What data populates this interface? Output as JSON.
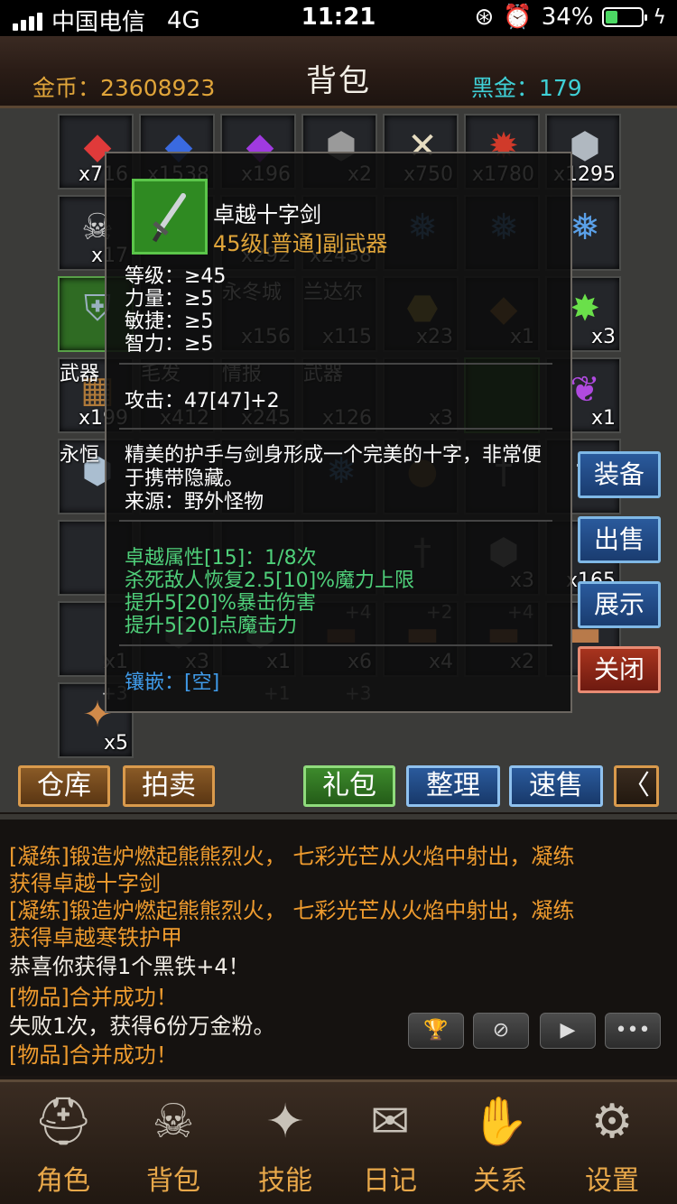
{
  "status_bar": {
    "carrier": "中国电信",
    "network": "4G",
    "time": "11:21",
    "battery": "34%"
  },
  "header": {
    "gold_label": "金币：23608923",
    "title": "背包",
    "blackgold_label": "黑金：179"
  },
  "slots": [
    {
      "icon": "◆",
      "color": "#e03a3a",
      "count": "x716"
    },
    {
      "icon": "◆",
      "color": "#3a6ae0",
      "count": "x1538"
    },
    {
      "icon": "◆",
      "color": "#a03ae0",
      "count": "x196"
    },
    {
      "icon": "⬢",
      "color": "#9a9a9a",
      "count": "x2"
    },
    {
      "icon": "✕",
      "color": "#e6dcc0",
      "count": "x750"
    },
    {
      "icon": "✹",
      "color": "#d03a2a",
      "count": "x1780"
    },
    {
      "icon": "⬢",
      "color": "#b0b8c0",
      "count": "x1295"
    },
    {
      "icon": "☠",
      "color": "#cfcfcf",
      "count": "x17"
    },
    {
      "icon": "",
      "color": "#888",
      "count": ""
    },
    {
      "icon": "",
      "color": "#888",
      "count": "x292"
    },
    {
      "icon": "",
      "color": "#888",
      "count": "x2438"
    },
    {
      "icon": "❅",
      "color": "#5aa0e8",
      "count": ""
    },
    {
      "icon": "❅",
      "color": "#5aa0e8",
      "count": ""
    },
    {
      "icon": "❅",
      "color": "#5aa0e8",
      "count": ""
    },
    {
      "icon": "⛨",
      "color": "#9ab0c0",
      "count": ""
    },
    {
      "icon": "",
      "color": "#888",
      "count": ""
    },
    {
      "icon": "",
      "color": "#888",
      "count": "x156"
    },
    {
      "icon": "",
      "color": "#888",
      "count": "x115"
    },
    {
      "icon": "⬣",
      "color": "#e6c04c",
      "count": "x23"
    },
    {
      "icon": "◆",
      "color": "#c88a3a",
      "count": "x1"
    },
    {
      "icon": "✸",
      "color": "#6ae04a",
      "count": "x3"
    },
    {
      "icon": "▦",
      "color": "#b07a3a",
      "count": "x199"
    },
    {
      "icon": "",
      "color": "#888",
      "count": "x412"
    },
    {
      "icon": "",
      "color": "#888",
      "count": "x245"
    },
    {
      "icon": "",
      "color": "#888",
      "count": "x126"
    },
    {
      "icon": "",
      "color": "#888",
      "count": "x3"
    },
    {
      "icon": "",
      "color": "#888",
      "count": ""
    },
    {
      "icon": "❦",
      "color": "#b04ae0",
      "count": "x1"
    },
    {
      "icon": "⬢",
      "color": "#aabed0",
      "count": ""
    },
    {
      "icon": "",
      "color": "#888",
      "count": ""
    },
    {
      "icon": "",
      "color": "#888",
      "count": ""
    },
    {
      "icon": "❅",
      "color": "#5aa0e8",
      "count": ""
    },
    {
      "icon": "●",
      "color": "#8a6a3a",
      "count": ""
    },
    {
      "icon": "†",
      "color": "#9a9a9a",
      "count": ""
    },
    {
      "icon": "†",
      "color": "#c8c8c8",
      "count": ""
    },
    {
      "icon": "",
      "color": "#888",
      "count": ""
    },
    {
      "icon": "",
      "color": "#888",
      "count": ""
    },
    {
      "icon": "",
      "color": "#888",
      "count": ""
    },
    {
      "icon": "",
      "color": "#888",
      "count": ""
    },
    {
      "icon": "†",
      "color": "#888",
      "count": ""
    },
    {
      "icon": "⬢",
      "color": "#aaaaaa",
      "count": "x3"
    },
    {
      "icon": "",
      "color": "#888",
      "count": "x165"
    },
    {
      "icon": "",
      "color": "#888",
      "count": "x1"
    },
    {
      "icon": "⬢",
      "color": "#777",
      "count": "x3"
    },
    {
      "icon": "⬢",
      "color": "#777",
      "count": "x1"
    },
    {
      "icon": "▬",
      "color": "#8a5a3a",
      "count": "x6"
    },
    {
      "icon": "▬",
      "color": "#b87a4a",
      "count": "x4"
    },
    {
      "icon": "▬",
      "color": "#b87a4a",
      "count": "x2"
    },
    {
      "icon": "▬",
      "color": "#b87a4a",
      "count": "x1"
    },
    {
      "icon": "✦",
      "color": "#d08a4a",
      "count": "x5"
    }
  ],
  "slot_tags": {
    "weapon1": "武器",
    "hair": "毛发",
    "intel": "情报",
    "weapon2": "武器",
    "eternal": "永恒",
    "winter_city": "永冬城",
    "landar": "兰达尔"
  },
  "slot_plus": [
    "+4",
    "+2",
    "+4",
    "+3",
    "+1",
    "+3"
  ],
  "tooltip": {
    "name": "卓越十字剑",
    "subtitle": "45级[普通]副武器",
    "requirements": [
      "等级：≥45",
      "力量：≥5",
      "敏捷：≥5",
      "智力：≥5"
    ],
    "attack": "攻击：47[47]+2",
    "description": "精美的护手与剑身形成一个完美的十字，非常便于携带隐藏。",
    "source": "来源：野外怪物",
    "excellent_title": "卓越属性[15]：1/8次",
    "excellent_lines": [
      "杀死敌人恢复2.5[10]%魔力上限",
      "提升5[20]%暴击伤害",
      "提升5[20]点魔击力"
    ],
    "socket": "镶嵌：[空]"
  },
  "side_buttons": {
    "equip": "装备",
    "sell": "出售",
    "show": "展示",
    "close": "关闭"
  },
  "action_buttons": {
    "warehouse": "仓库",
    "auction": "拍卖",
    "gift": "礼包",
    "sort": "整理",
    "quick_sell": "速售",
    "collapse": "〈"
  },
  "log": [
    {
      "text": "[凝练]锻造炉燃起熊熊烈火，  七彩光芒从火焰中射出，凝练",
      "color": "orange"
    },
    {
      "text": "获得卓越十字剑",
      "color": "orange"
    },
    {
      "text": "[凝练]锻造炉燃起熊熊烈火，  七彩光芒从火焰中射出，凝练",
      "color": "orange"
    },
    {
      "text": "获得卓越寒铁护甲",
      "color": "orange"
    },
    {
      "text": "恭喜你获得1个黑铁+4！",
      "color": "white"
    },
    {
      "text": "[物品]合并成功！",
      "color": "orange"
    },
    {
      "text": "失败1次，获得6份万金粉。",
      "color": "white"
    },
    {
      "text": "[物品]合并成功！",
      "color": "orange"
    }
  ],
  "nav": {
    "character": "角色",
    "bag": "背包",
    "skills": "技能",
    "diary": "日记",
    "relations": "关系",
    "settings": "设置"
  }
}
